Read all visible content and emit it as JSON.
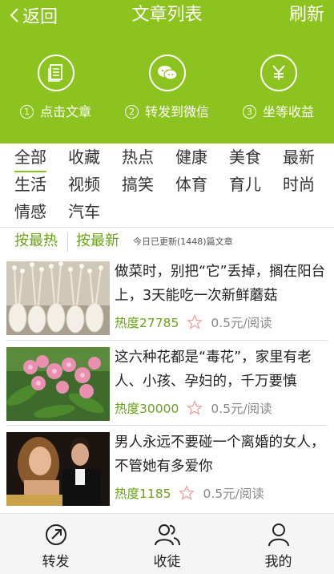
{
  "header": {
    "back_label": "返回",
    "title": "文章列表",
    "refresh_label": "刷新"
  },
  "steps": [
    {
      "num": "1",
      "label": "点击文章",
      "icon": "document-icon"
    },
    {
      "num": "2",
      "label": "转发到微信",
      "icon": "wechat-icon"
    },
    {
      "num": "3",
      "label": "坐等收益",
      "icon": "yen-icon"
    }
  ],
  "categories": [
    "全部",
    "收藏",
    "热点",
    "健康",
    "美食",
    "最新",
    "生活",
    "视频",
    "搞笑",
    "体育",
    "育儿",
    "时尚",
    "情感",
    "汽车"
  ],
  "active_category": "全部",
  "sort": {
    "hot_label": "按最热",
    "latest_label": "按最新",
    "updated_text": "今日已更新(1448)篇文章"
  },
  "articles": [
    {
      "title": "做菜时，别把“它”丢掉，搁在阳台上，3天能吃一次新鲜蘑菇",
      "heat": "热度27785",
      "price": "0.5元/阅读",
      "image": "mushroom-photo"
    },
    {
      "title": "这六种花都是“毒花”，家里有老人、小孩、孕妇的，千万要慎",
      "heat": "热度30000",
      "price": "0.5元/阅读",
      "image": "flower-photo"
    },
    {
      "title": "男人永远不要碰一个离婚的女人，不管她有多爱你",
      "heat": "热度1185",
      "price": "0.5元/阅读",
      "image": "couple-photo"
    }
  ],
  "tabs": [
    {
      "label": "转发",
      "icon": "share-icon"
    },
    {
      "label": "收徒",
      "icon": "users-icon"
    },
    {
      "label": "我的",
      "icon": "user-icon"
    }
  ],
  "colors": {
    "brand": "#8cc31e",
    "accent_text": "#6aa315"
  }
}
